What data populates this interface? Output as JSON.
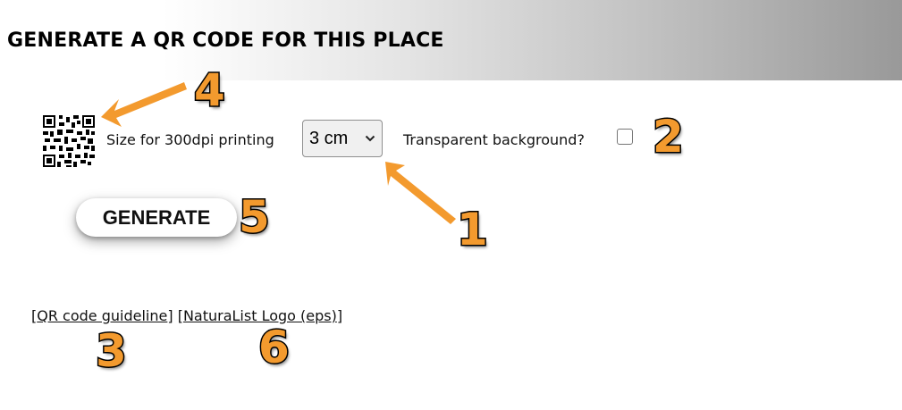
{
  "header": {
    "title": "GENERATE A QR CODE FOR THIS PLACE"
  },
  "form": {
    "size_label": "Size for 300dpi printing",
    "size_select": {
      "value": "3 cm"
    },
    "transparent_label": "Transparent background?",
    "transparent_checked": false,
    "generate_label": "GENERATE"
  },
  "links": {
    "guideline": "QR code guideline",
    "logo": "NaturaList Logo (eps)"
  },
  "annotations": {
    "color": "#f39a2e",
    "labels": [
      "1",
      "2",
      "3",
      "4",
      "5",
      "6"
    ]
  }
}
